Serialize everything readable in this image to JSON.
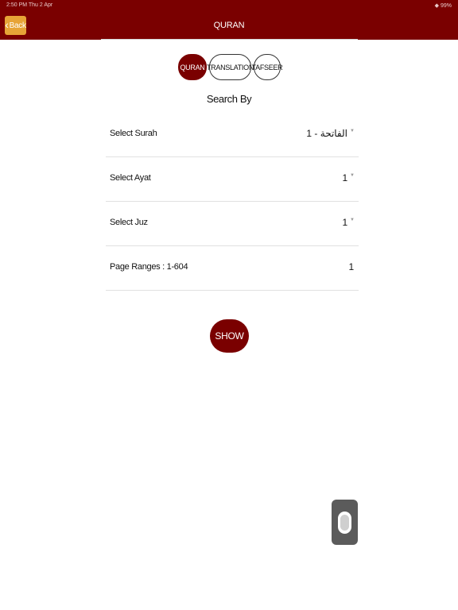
{
  "status_bar": {
    "time": "2:50 PM  Thu 2 Apr",
    "right": "◆ 99%"
  },
  "nav": {
    "back_label": "Back",
    "title": "QURAN"
  },
  "segments": {
    "quran": "QURAN",
    "translation": "TRANSLATION",
    "tafseer": "TAFSEER",
    "selected": "QURAN"
  },
  "search_by": "Search By",
  "rows": {
    "surah": {
      "label": "Select Surah",
      "value": "الفاتحة - 1"
    },
    "ayat": {
      "label": "Select Ayat",
      "value": "1"
    },
    "juz": {
      "label": "Select Juz",
      "value": "1"
    },
    "page": {
      "label": "Page Ranges : 1-604",
      "value": "1"
    }
  },
  "show_label": "SHOW",
  "colors": {
    "primary": "#7a0000",
    "back_button": "#e7a437",
    "float_button": "#5b5b5b"
  },
  "icons": {
    "back": "chevron-left-icon",
    "dropdown": "caret-down-icon",
    "floating": "capsule-icon"
  }
}
